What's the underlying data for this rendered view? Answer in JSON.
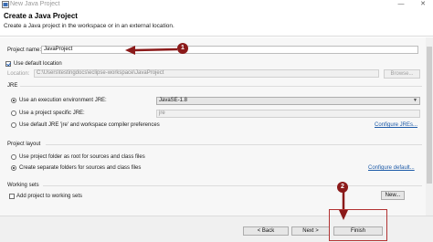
{
  "window": {
    "title": "New Java Project"
  },
  "header": {
    "title": "Create a Java Project",
    "description": "Create a Java project in the workspace or in an external location."
  },
  "project_name": {
    "label": "Project name:",
    "value": "JavaProject"
  },
  "location": {
    "use_default_label": "Use default location",
    "use_default_checked": true,
    "label": "Location:",
    "value": "C:\\Users\\testingdocs\\eclipse-workspace\\JavaProject",
    "browse_label": "Browse..."
  },
  "jre": {
    "section_label": "JRE",
    "option_env_label": "Use an execution environment JRE:",
    "env_value": "JavaSE-1.8",
    "option_specific_label": "Use a project specific JRE:",
    "specific_value": "jre",
    "option_default_label": "Use default JRE 'jre' and workspace compiler preferences",
    "configure_link": "Configure JREs..."
  },
  "project_layout": {
    "section_label": "Project layout",
    "option_root_label": "Use project folder as root for sources and class files",
    "option_separate_label": "Create separate folders for sources and class files",
    "configure_link": "Configure default..."
  },
  "working_sets": {
    "section_label": "Working sets",
    "add_label": "Add project to working sets",
    "new_label": "New..."
  },
  "footer": {
    "back_label": "< Back",
    "next_label": "Next >",
    "finish_label": "Finish"
  },
  "annotations": {
    "marker_1": "1",
    "marker_2": "2",
    "accent_color": "#8b1a1a"
  }
}
